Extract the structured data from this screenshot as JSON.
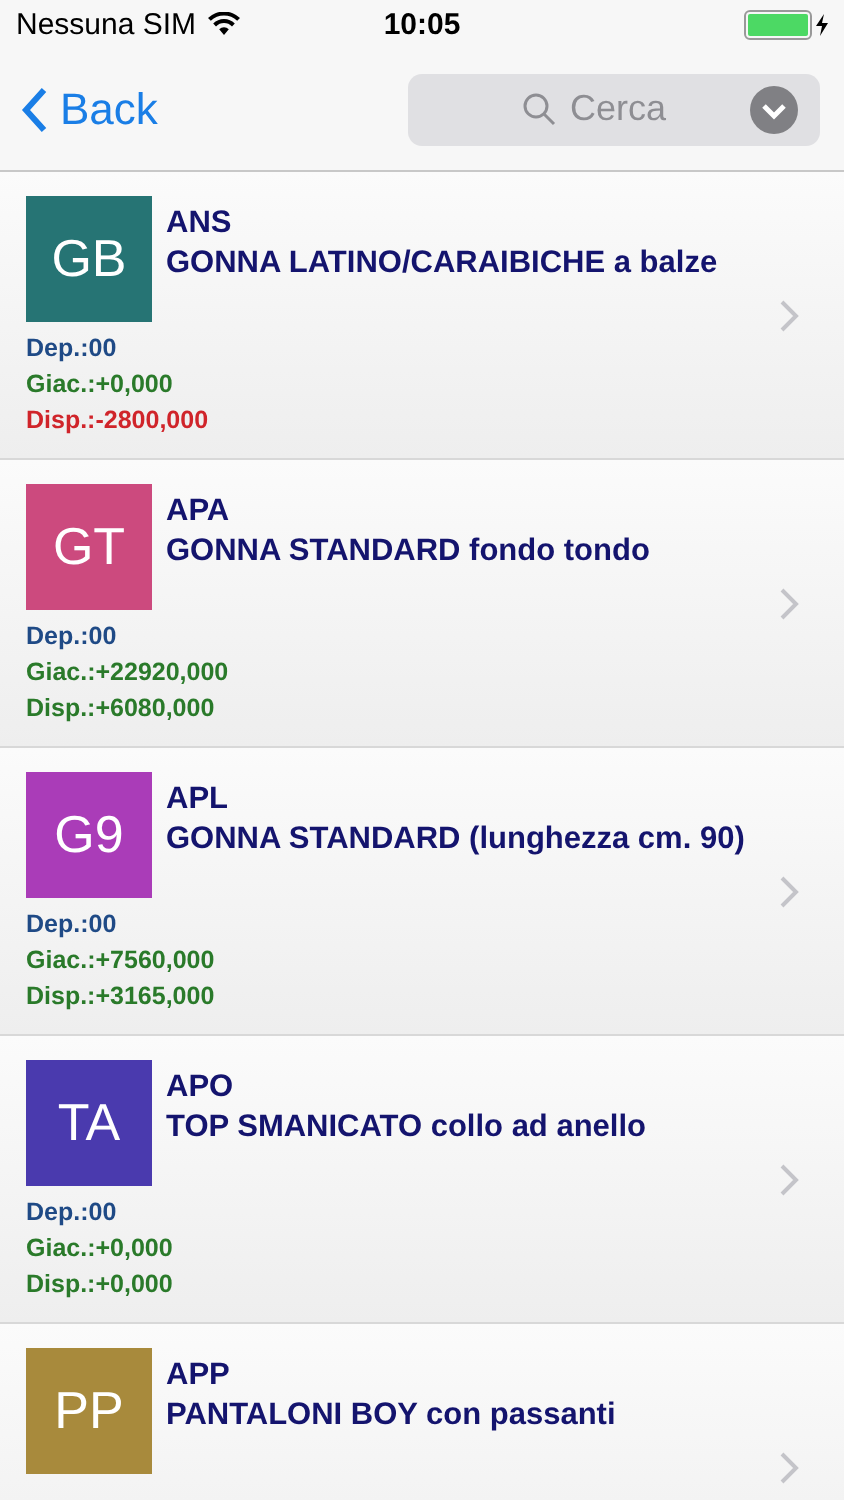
{
  "status_bar": {
    "carrier": "Nessuna SIM",
    "time": "10:05",
    "battery": {
      "level": 1.0,
      "charging": true
    }
  },
  "nav": {
    "back": "Back",
    "search": {
      "placeholder": "Cerca"
    }
  },
  "items": [
    {
      "initials": "GB",
      "color": "#267474",
      "code": "ANS",
      "name": "GONNA LATINO/CARAIBICHE a balze",
      "stats": [
        {
          "text": "Dep.:00",
          "color": "#1f4a86"
        },
        {
          "text": "Giac.:+0,000",
          "color": "#2a7a2a"
        },
        {
          "text": "Disp.:-2800,000",
          "color": "#d0242a"
        }
      ]
    },
    {
      "initials": "GT",
      "color": "#cc4a7e",
      "code": "APA",
      "name": "GONNA STANDARD fondo tondo",
      "stats": [
        {
          "text": "Dep.:00",
          "color": "#1f4a86"
        },
        {
          "text": "Giac.:+22920,000",
          "color": "#2a7a2a"
        },
        {
          "text": "Disp.:+6080,000",
          "color": "#2a7a2a"
        }
      ]
    },
    {
      "initials": "G9",
      "color": "#aa3cb8",
      "code": "APL",
      "name": "GONNA STANDARD (lunghezza cm. 90)",
      "stats": [
        {
          "text": "Dep.:00",
          "color": "#1f4a86"
        },
        {
          "text": "Giac.:+7560,000",
          "color": "#2a7a2a"
        },
        {
          "text": "Disp.:+3165,000",
          "color": "#2a7a2a"
        }
      ]
    },
    {
      "initials": "TA",
      "color": "#4a3aae",
      "code": "APO",
      "name": "TOP SMANICATO collo ad anello",
      "stats": [
        {
          "text": "Dep.:00",
          "color": "#1f4a86"
        },
        {
          "text": "Giac.:+0,000",
          "color": "#2a7a2a"
        },
        {
          "text": "Disp.:+0,000",
          "color": "#2a7a2a"
        }
      ]
    },
    {
      "initials": "PP",
      "color": "#a88a3c",
      "code": "APP",
      "name": "PANTALONI BOY con passanti"
    }
  ]
}
